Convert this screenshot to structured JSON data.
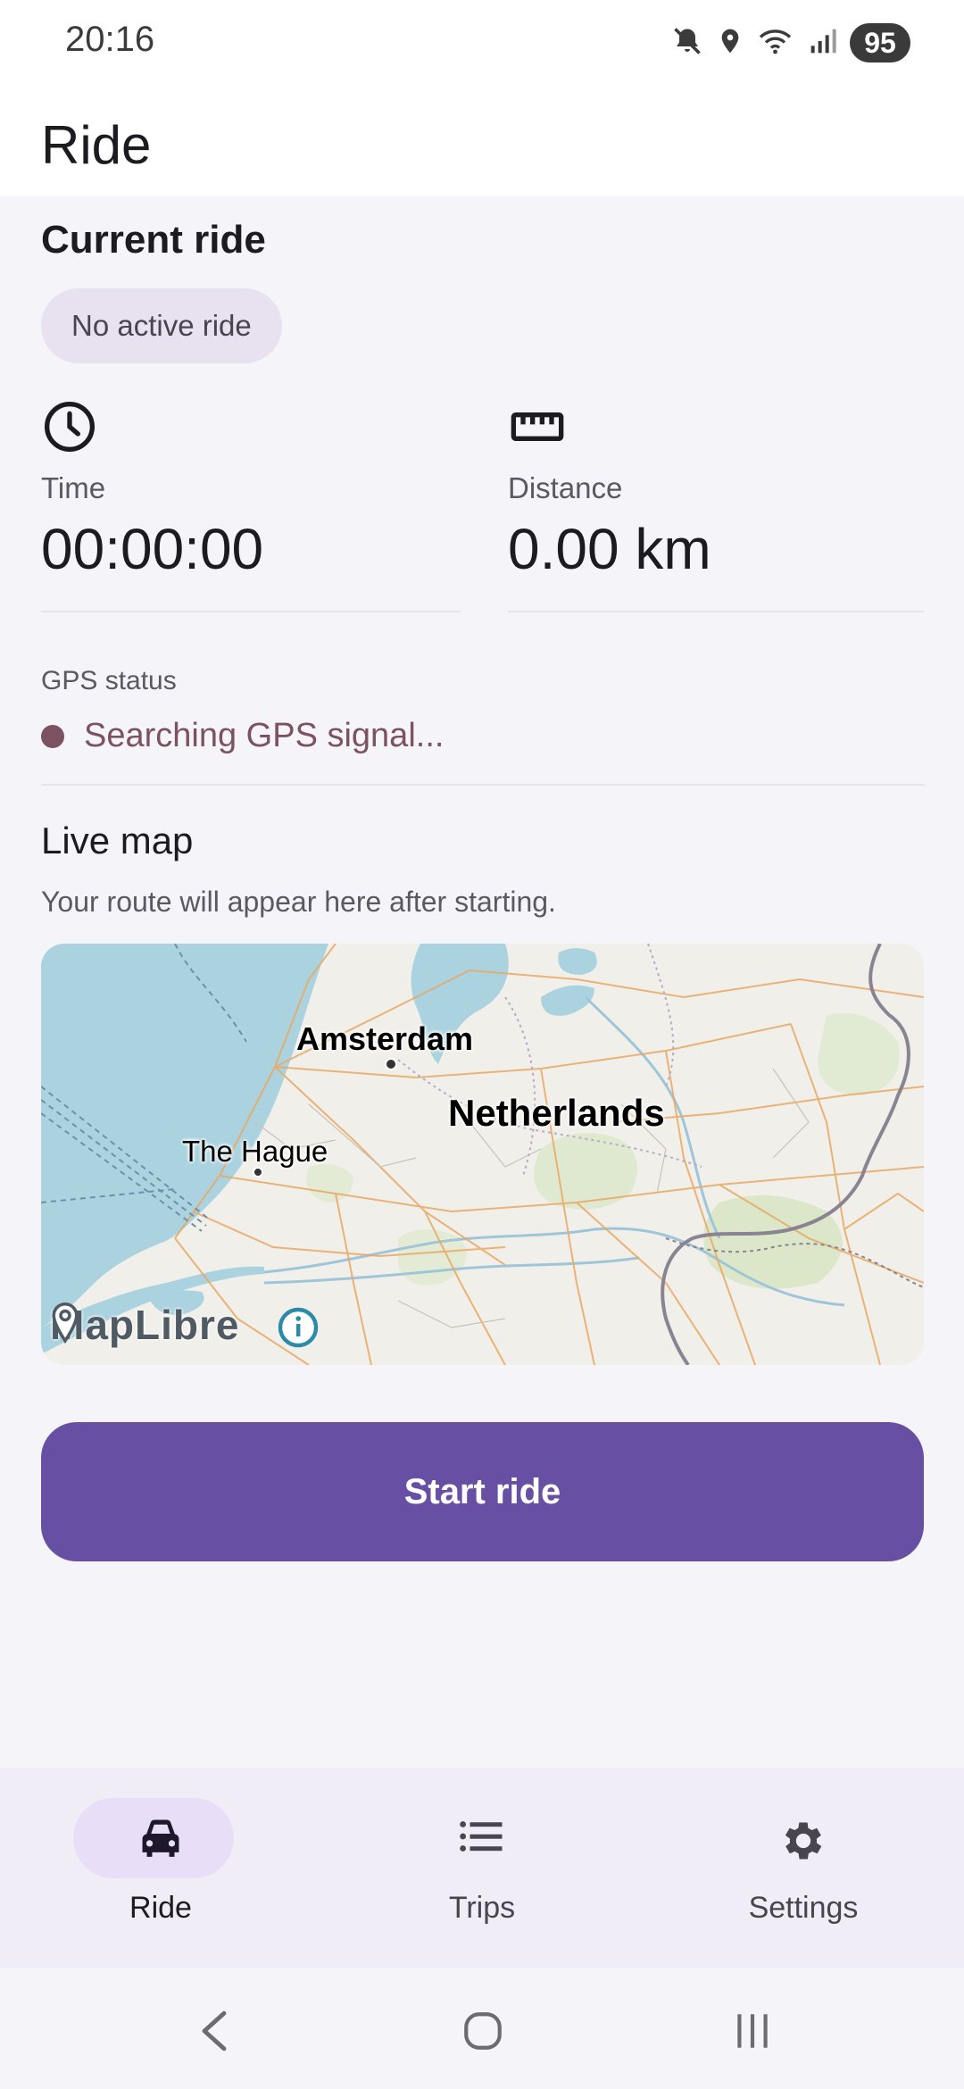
{
  "status_bar": {
    "time": "20:16",
    "battery": "95",
    "icons": [
      "mute-icon",
      "location-icon",
      "wifi-icon",
      "signal-icon"
    ]
  },
  "header": {
    "title": "Ride"
  },
  "current_ride": {
    "title": "Current ride",
    "status_chip": "No active ride",
    "time_label": "Time",
    "time_value": "00:00:00",
    "distance_label": "Distance",
    "distance_value": "0.00 km"
  },
  "gps": {
    "label": "GPS status",
    "status": "Searching GPS signal...",
    "status_color": "#7d5260"
  },
  "map": {
    "title": "Live map",
    "subtitle": "Your route will appear here after starting.",
    "labels": {
      "amsterdam": "Amsterdam",
      "netherlands": "Netherlands",
      "the_hague": "The Hague"
    },
    "attribution": "MapLibre"
  },
  "actions": {
    "start_ride": "Start ride"
  },
  "bottom_nav": {
    "items": [
      {
        "label": "Ride",
        "icon": "car-icon",
        "active": true
      },
      {
        "label": "Trips",
        "icon": "list-icon",
        "active": false
      },
      {
        "label": "Settings",
        "icon": "gear-icon",
        "active": false
      }
    ]
  },
  "colors": {
    "primary": "#6750a4",
    "chip": "#e8e1ef",
    "nav_background": "#f1edf7",
    "nav_pill": "#e8def8"
  }
}
